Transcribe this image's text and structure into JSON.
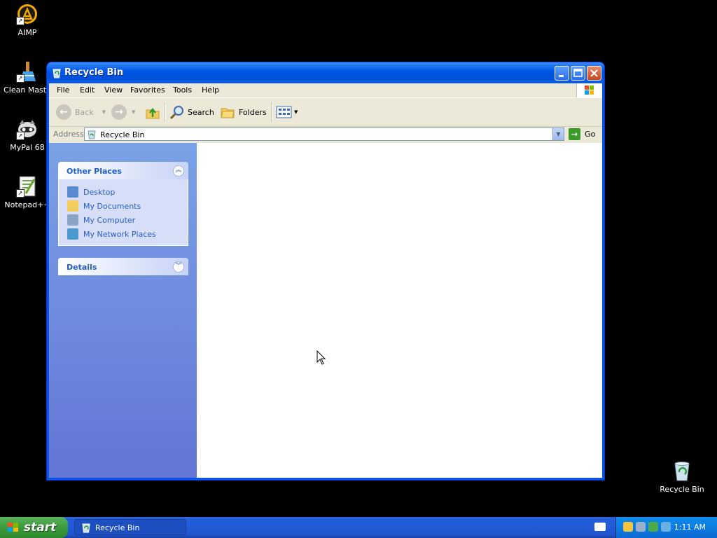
{
  "desktop": {
    "icons": [
      {
        "label": "AIMP",
        "icon": "aimp-icon"
      },
      {
        "label": "Clean Maste",
        "icon": "clean-master-icon"
      },
      {
        "label": "MyPal 68",
        "icon": "mypal-icon"
      },
      {
        "label": "Notepad++",
        "icon": "notepad-plus-plus-icon"
      },
      {
        "label": "Recycle Bin",
        "icon": "recycle-bin-icon"
      }
    ]
  },
  "window": {
    "title": "Recycle Bin",
    "menu": [
      "File",
      "Edit",
      "View",
      "Favorites",
      "Tools",
      "Help"
    ],
    "toolbar": {
      "back": "Back",
      "search": "Search",
      "folders": "Folders"
    },
    "address": {
      "label": "Address",
      "value": "Recycle Bin",
      "go": "Go"
    },
    "taskpane": {
      "other_places": {
        "title": "Other Places",
        "links": [
          "Desktop",
          "My Documents",
          "My Computer",
          "My Network Places"
        ]
      },
      "details": {
        "title": "Details"
      }
    }
  },
  "taskbar": {
    "start": "start",
    "task_item": "Recycle Bin",
    "clock": "1:11 AM"
  },
  "colors": {
    "title_blue": "#0058e6",
    "taskpane_link": "#215dc6",
    "start_green": "#3c9a3c"
  }
}
